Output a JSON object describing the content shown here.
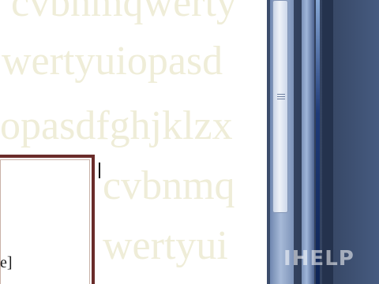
{
  "watermark_lines": [
    "cvbnmqwerty",
    "wertyuiopasd",
    "opasdfghjklzx",
    "cvbnmq",
    "wertyui"
  ],
  "textbox": {
    "fragment": "e]"
  },
  "scrollbar": {
    "thumb_icon": "grip-lines-icon"
  },
  "logo_text": "IHELP"
}
